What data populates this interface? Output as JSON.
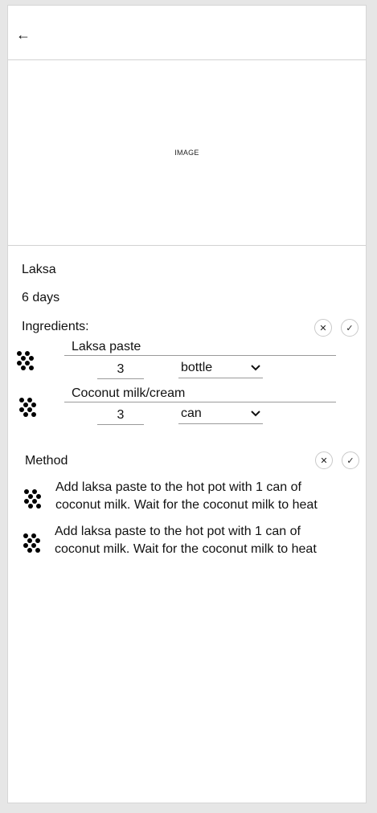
{
  "header": {
    "back_icon": "arrow-left-icon",
    "back_glyph": "←"
  },
  "hero_image": {
    "placeholder": "IMAGE"
  },
  "recipe": {
    "name": "Laksa",
    "duration": "6 days"
  },
  "ingredients": {
    "heading": "Ingredients:",
    "cancel_glyph": "✕",
    "confirm_glyph": "✓",
    "items": [
      {
        "name": "Laksa paste",
        "quantity": "3",
        "unit": "bottle"
      },
      {
        "name": "Coconut milk/cream",
        "quantity": "3",
        "unit": "can"
      }
    ]
  },
  "method": {
    "heading": "Method",
    "cancel_glyph": "✕",
    "confirm_glyph": "✓",
    "steps": [
      {
        "text": "Add laksa paste to the hot pot with 1 can of coconut milk. Wait for the coconut milk to heat"
      },
      {
        "text": "Add laksa paste to the hot pot with 1 can of coconut milk. Wait for the coconut milk to heat"
      }
    ]
  }
}
